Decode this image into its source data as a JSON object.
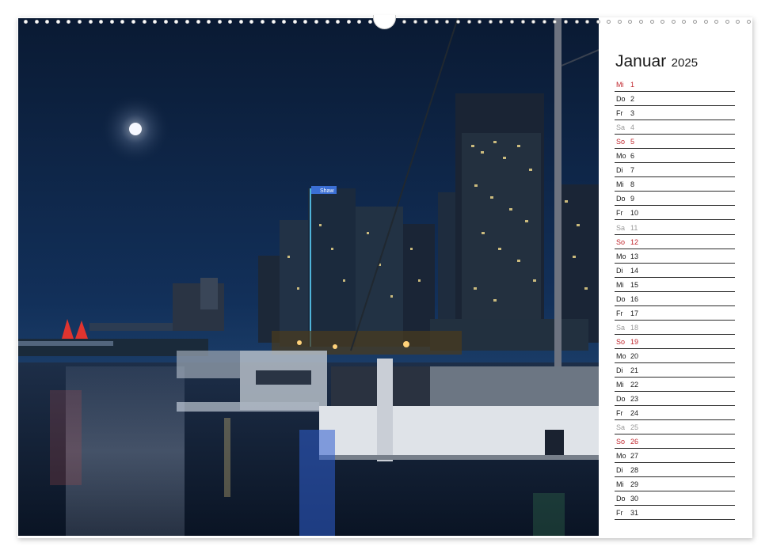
{
  "calendar": {
    "month": "Januar",
    "year": "2025",
    "days": [
      {
        "abbr": "Mi",
        "num": "1",
        "type": "holiday"
      },
      {
        "abbr": "Do",
        "num": "2",
        "type": "weekday"
      },
      {
        "abbr": "Fr",
        "num": "3",
        "type": "weekday"
      },
      {
        "abbr": "Sa",
        "num": "4",
        "type": "saturday"
      },
      {
        "abbr": "So",
        "num": "5",
        "type": "sunday"
      },
      {
        "abbr": "Mo",
        "num": "6",
        "type": "weekday"
      },
      {
        "abbr": "Di",
        "num": "7",
        "type": "weekday"
      },
      {
        "abbr": "Mi",
        "num": "8",
        "type": "weekday"
      },
      {
        "abbr": "Do",
        "num": "9",
        "type": "weekday"
      },
      {
        "abbr": "Fr",
        "num": "10",
        "type": "weekday"
      },
      {
        "abbr": "Sa",
        "num": "11",
        "type": "saturday"
      },
      {
        "abbr": "So",
        "num": "12",
        "type": "sunday"
      },
      {
        "abbr": "Mo",
        "num": "13",
        "type": "weekday"
      },
      {
        "abbr": "Di",
        "num": "14",
        "type": "weekday"
      },
      {
        "abbr": "Mi",
        "num": "15",
        "type": "weekday"
      },
      {
        "abbr": "Do",
        "num": "16",
        "type": "weekday"
      },
      {
        "abbr": "Fr",
        "num": "17",
        "type": "weekday"
      },
      {
        "abbr": "Sa",
        "num": "18",
        "type": "saturday"
      },
      {
        "abbr": "So",
        "num": "19",
        "type": "sunday"
      },
      {
        "abbr": "Mo",
        "num": "20",
        "type": "weekday"
      },
      {
        "abbr": "Di",
        "num": "21",
        "type": "weekday"
      },
      {
        "abbr": "Mi",
        "num": "22",
        "type": "weekday"
      },
      {
        "abbr": "Do",
        "num": "23",
        "type": "weekday"
      },
      {
        "abbr": "Fr",
        "num": "24",
        "type": "weekday"
      },
      {
        "abbr": "Sa",
        "num": "25",
        "type": "saturday"
      },
      {
        "abbr": "So",
        "num": "26",
        "type": "sunday"
      },
      {
        "abbr": "Mo",
        "num": "27",
        "type": "weekday"
      },
      {
        "abbr": "Di",
        "num": "28",
        "type": "weekday"
      },
      {
        "abbr": "Mi",
        "num": "29",
        "type": "weekday"
      },
      {
        "abbr": "Do",
        "num": "30",
        "type": "weekday"
      },
      {
        "abbr": "Fr",
        "num": "31",
        "type": "weekday"
      }
    ]
  },
  "photo": {
    "sign_text": "Shaw"
  },
  "colors": {
    "sky": "#0c1f3c",
    "sunday_red": "#c0262d",
    "saturday_gray": "#9a9a9a",
    "rule_line": "#2a2a2a"
  }
}
